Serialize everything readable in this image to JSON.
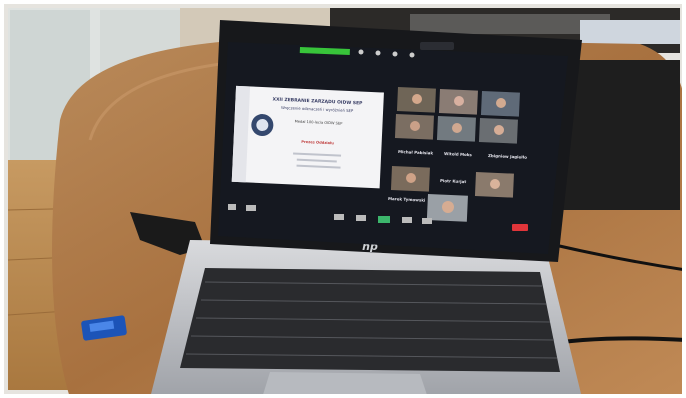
{
  "presentation": {
    "title": "XXII ZEBRANIE ZARZĄDU OIDW SEP",
    "subtitle": "Wręczenie odznaczeń i wyróżnień SEP",
    "line3": "Medal 100-lecia OIDW SEP",
    "presenter": "Prezes Oddziału"
  },
  "participants": [
    {
      "name": "Michał Pabisiak"
    },
    {
      "name": "Witold Moks"
    },
    {
      "name": "Zbigniew Jagiełło"
    },
    {
      "name": "Piotr Kurjat"
    },
    {
      "name": "Marek Tymowski"
    }
  ],
  "brand": {
    "laptop_logo": "hp"
  },
  "colors": {
    "zoom_bg": "#151820",
    "desk": "#b07a4c",
    "wall": "#d8d8d4",
    "active_speaker": "#38c43a"
  },
  "icons": [
    "mute-icon",
    "video-icon",
    "participants-icon",
    "share-screen-icon",
    "chat-icon",
    "record-icon",
    "end-call-icon"
  ]
}
